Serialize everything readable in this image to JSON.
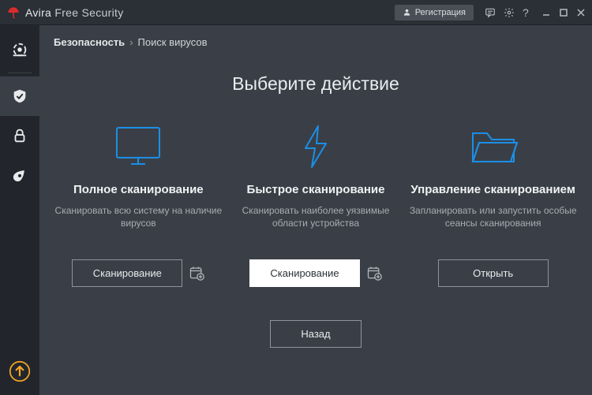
{
  "brand": {
    "name": "Avira",
    "suffix": "Free Security"
  },
  "titlebar": {
    "register_label": "Регистрация"
  },
  "breadcrumb": {
    "root": "Безопасность",
    "separator": "›",
    "leaf": "Поиск вирусов"
  },
  "page": {
    "title": "Выберите действие"
  },
  "cards": [
    {
      "title": "Полное сканирование",
      "desc": "Сканировать всю систему на наличие вирусов",
      "button": "Сканирование"
    },
    {
      "title": "Быстрое сканирование",
      "desc": "Сканировать наиболее уязвимые области устройства",
      "button": "Сканирование"
    },
    {
      "title": "Управление сканированием",
      "desc": "Запланировать или запустить особые сеансы сканирования",
      "button": "Открыть"
    }
  ],
  "back_label": "Назад"
}
